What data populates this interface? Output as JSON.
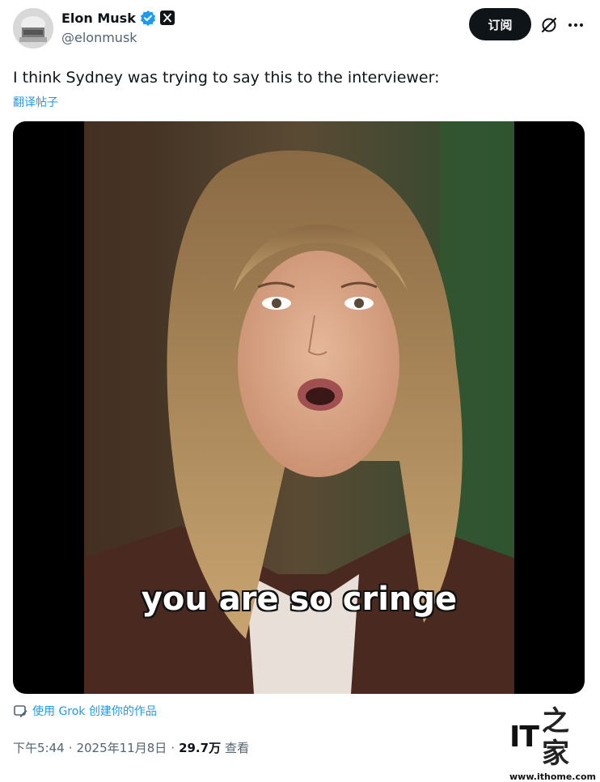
{
  "author": {
    "display_name": "Elon Musk",
    "handle": "@elonmusk"
  },
  "header": {
    "subscribe_label": "订阅"
  },
  "tweet": {
    "text": "I think Sydney was trying to say this to the interviewer:",
    "translate_label": "翻译帖子"
  },
  "media": {
    "caption": "you are so cringe"
  },
  "grok": {
    "label": "使用 Grok 创建你的作品"
  },
  "meta": {
    "time": "下午5:44",
    "date": "2025年11月8日",
    "separator": "·",
    "views_count": "29.7万",
    "views_label": "查看"
  },
  "watermark": {
    "logo_text": "IT",
    "logo_chinese": "之家",
    "url": "www.ithome.com"
  },
  "colors": {
    "accent": "#1d9bf0",
    "text_primary": "#0f1419",
    "text_secondary": "#536471",
    "button_bg": "#0f1419"
  },
  "icons": {
    "verified": "verified-badge-icon",
    "x_logo": "x-logo-icon",
    "grok": "grok-icon",
    "more": "more-horizontal-icon",
    "grok_edit": "grok-edit-icon"
  }
}
